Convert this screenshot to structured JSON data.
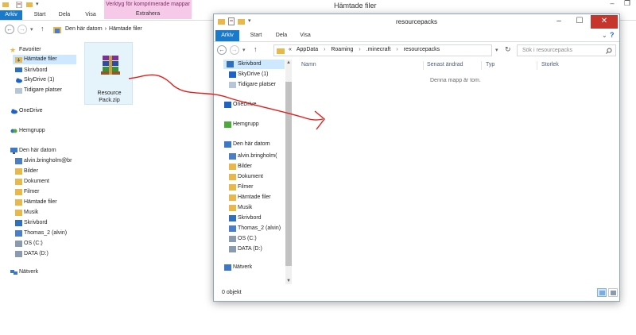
{
  "back_window": {
    "title": "Hämtade filer",
    "context_tab_title": "Verktyg för komprimerade mappar",
    "context_tab_sub": "Extrahera",
    "tabs": [
      "Arkiv",
      "Start",
      "Dela",
      "Visa"
    ],
    "breadcrumbs": [
      "Den här datorn",
      "›",
      "Hämtade filer"
    ],
    "nav": {
      "favorites_header": "Favoriter",
      "favorites": [
        "Hämtade filer",
        "Skrivbord",
        "SkyDrive (1)",
        "Tidigare platser"
      ],
      "onedrive": "OneDrive",
      "homegroup": "Hemgrupp",
      "pc_header": "Den här datorn",
      "pc_items": [
        "alvin.bringholm@br",
        "Bilder",
        "Dokument",
        "Filmer",
        "Hämtade filer",
        "Musik",
        "Skrivbord",
        "Thomas_2 (alvin)",
        "OS (C:)",
        "DATA (D:)"
      ],
      "network": "Nätverk"
    },
    "file": {
      "name_line1": "Resource",
      "name_line2": "Pack.zip",
      "icon": "winrar-archive-icon"
    }
  },
  "front_window": {
    "title": "resourcepacks",
    "tabs": [
      "Arkiv",
      "Start",
      "Dela",
      "Visa"
    ],
    "breadcrumbs": [
      "«",
      "AppData",
      "›",
      "Roaming",
      "›",
      ".minecraft",
      "›",
      "resourcepacks"
    ],
    "search_placeholder": "Sök i resourcepacks",
    "nav_items": [
      "Skrivbord",
      "SkyDrive (1)",
      "Tidigare platser",
      "OneDrive",
      "Hemgrupp",
      "Den här datorn",
      "alvin.bringholm(",
      "Bilder",
      "Dokument",
      "Filmer",
      "Hämtade filer",
      "Musik",
      "Skrivbord",
      "Thomas_2 (alvin)",
      "OS (C:)",
      "DATA (D:)",
      "Nätverk"
    ],
    "columns": [
      "Namn",
      "Senast ändrad",
      "Typ",
      "Storlek"
    ],
    "empty_message": "Denna mapp är tom.",
    "status": "0 objekt"
  },
  "colors": {
    "file_tab": "#1979ca",
    "context_tab": "#f6c9e8",
    "close_button": "#c7362c",
    "selection": "#cde8ff",
    "annotation_arrow": "#e0201c"
  }
}
